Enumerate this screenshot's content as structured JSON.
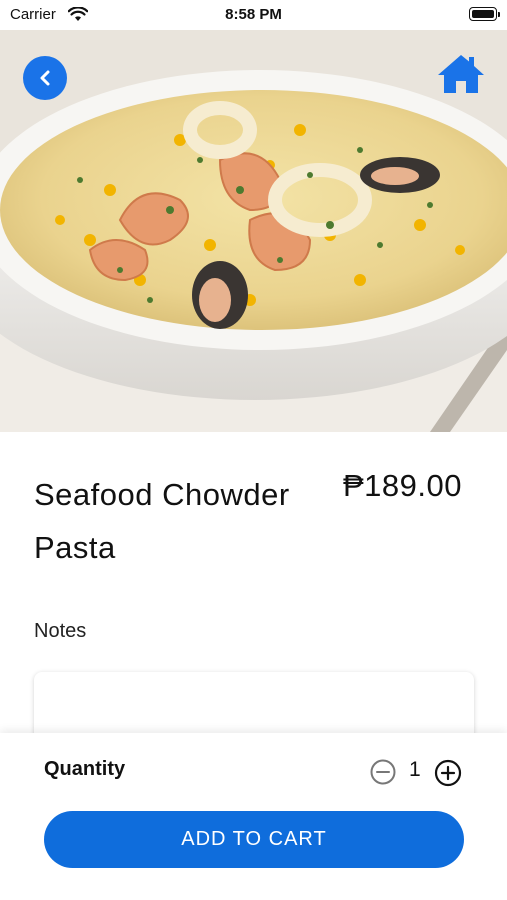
{
  "status_bar": {
    "carrier": "Carrier",
    "time": "8:58 PM"
  },
  "hero": {
    "image_subject": "seafood chowder in white bowl"
  },
  "nav": {
    "back_icon": "chevron-left-icon",
    "home_icon": "home-icon",
    "accent": "#1a73e8"
  },
  "product": {
    "name": "Seafood Chowder Pasta",
    "price": "₱189.00"
  },
  "notes": {
    "label": "Notes",
    "value": "",
    "placeholder": ""
  },
  "quantity": {
    "label": "Quantity",
    "value": "1",
    "minus_icon": "minus-circle-icon",
    "plus_icon": "plus-circle-icon"
  },
  "cart": {
    "button_label": "ADD TO CART",
    "color": "#0f6ddc"
  }
}
